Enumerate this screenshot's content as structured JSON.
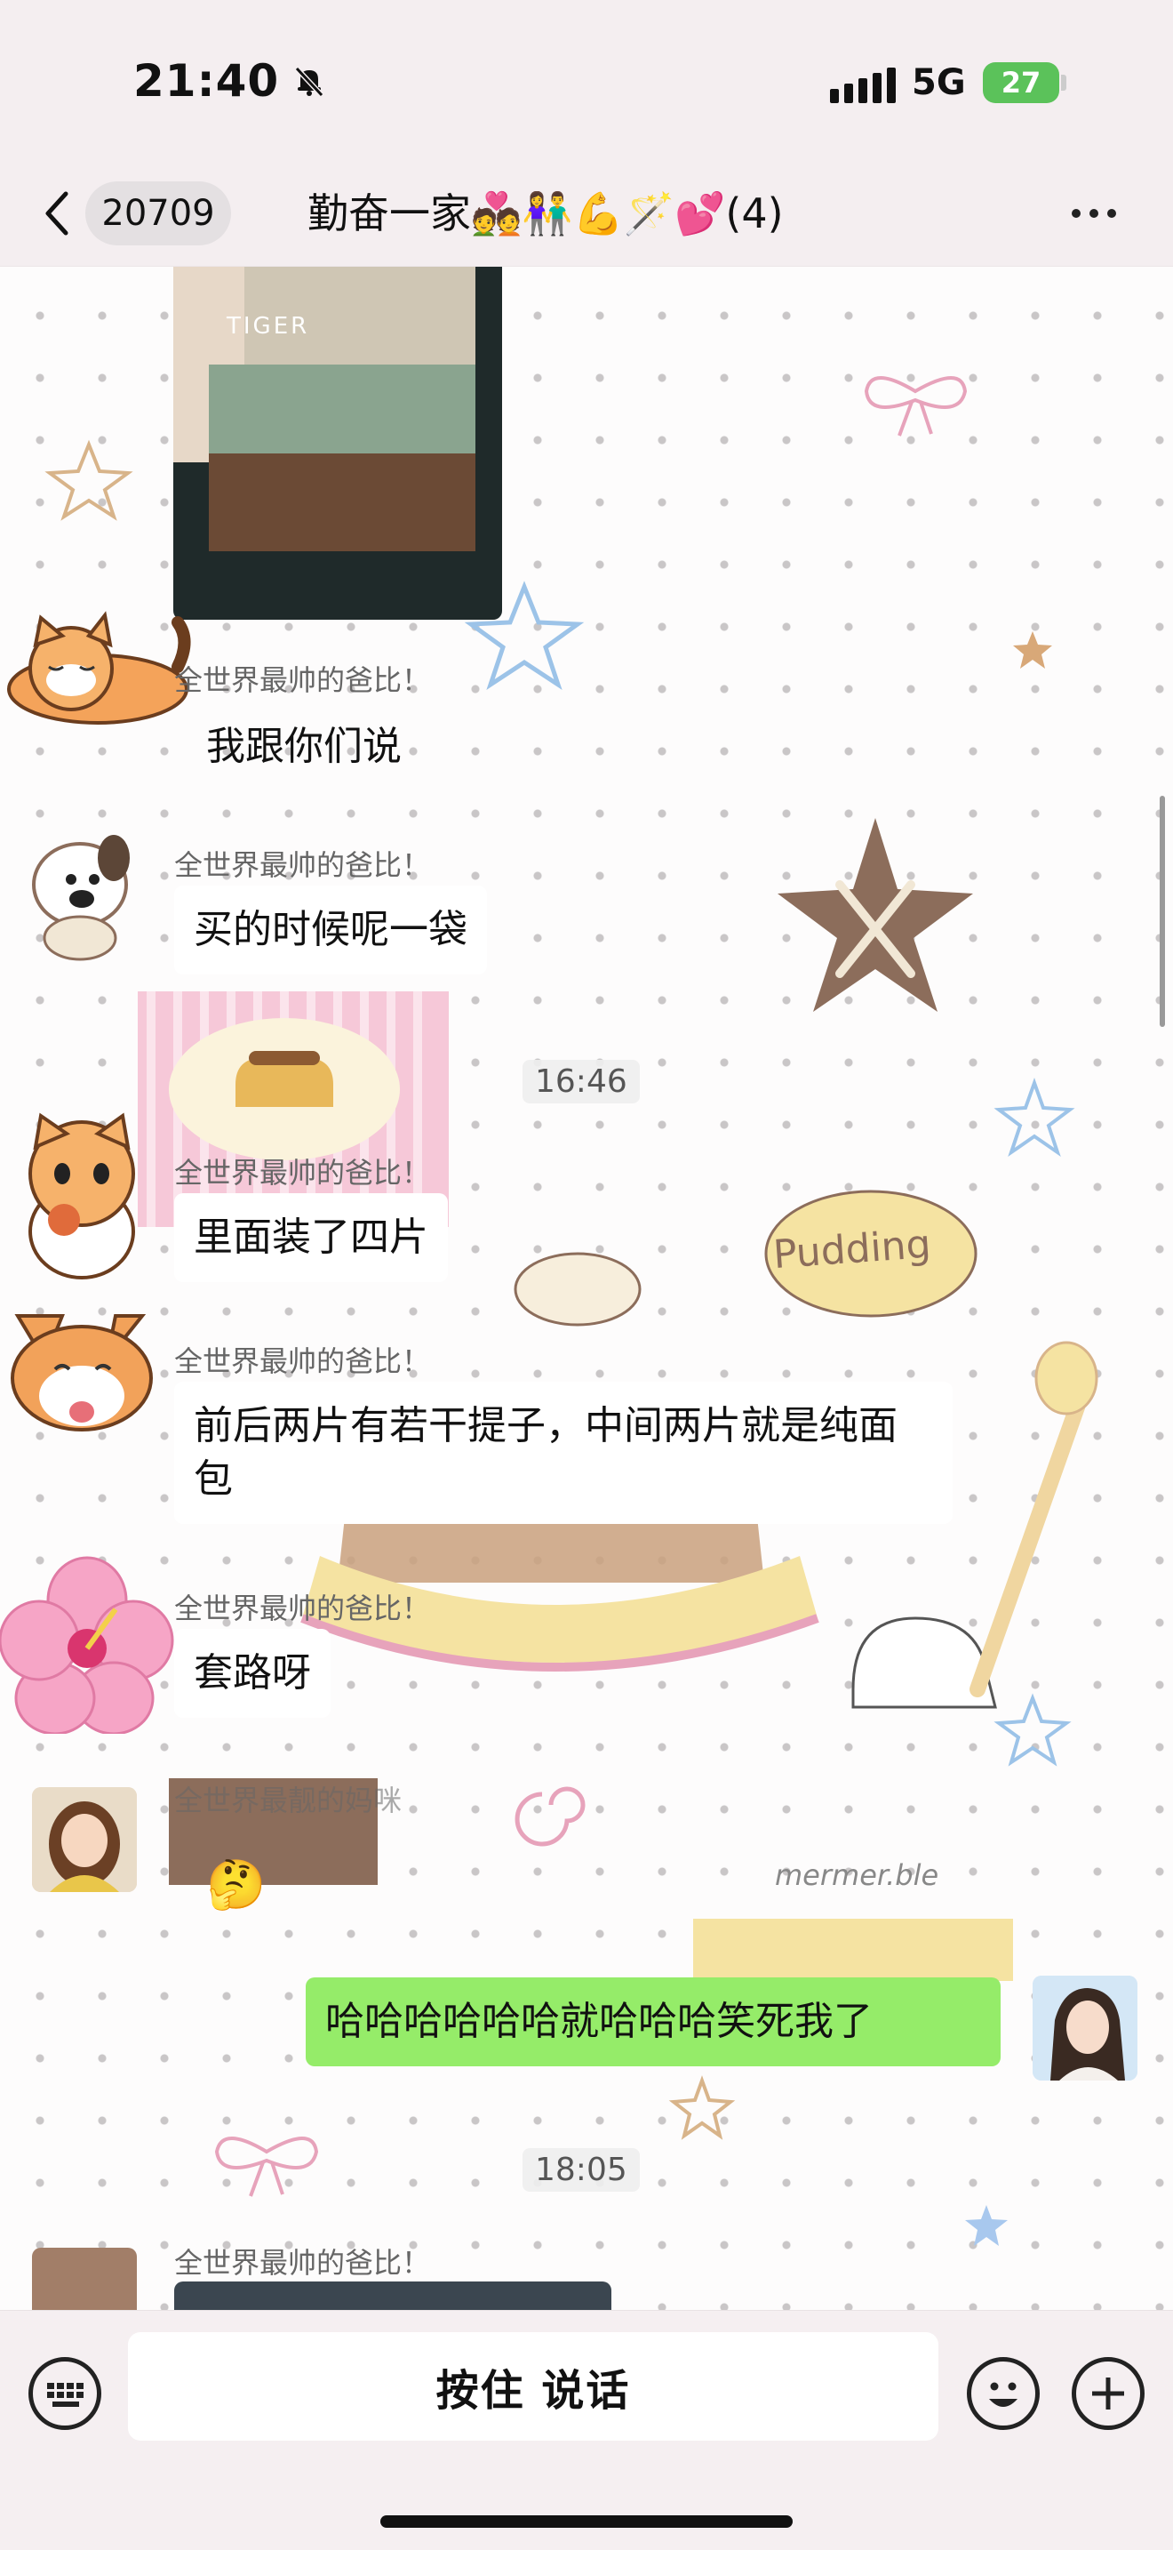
{
  "status_bar": {
    "time": "21:40",
    "network": "5G",
    "battery": "27"
  },
  "header": {
    "unread_count": "20709",
    "title": "勤奋一家💑👫💪🪄💕(4)"
  },
  "messages": [
    {
      "sender": "全世界最帅的爸比！",
      "text": "我跟你们说"
    },
    {
      "sender": "全世界最帅的爸比！",
      "text": "买的时候呢一袋"
    },
    {
      "sender": "全世界最帅的爸比！",
      "text": "里面装了四片"
    },
    {
      "sender": "全世界最帅的爸比！",
      "text": "前后两片有若干提子，中间两片就是纯面包"
    },
    {
      "sender": "全世界最帅的爸比！",
      "text": "套路呀"
    },
    {
      "sender": "全世界最靓的妈咪",
      "text": "🤔"
    },
    {
      "sender": "",
      "text": "哈哈哈哈哈哈就哈哈哈笑死我了"
    },
    {
      "sender": "全世界最帅的爸比！",
      "text": ""
    }
  ],
  "timestamps": [
    "16:46",
    "18:05"
  ],
  "image_overlay_text": "TIGER",
  "wallpaper_labels": {
    "pudding": "Pudding",
    "watermark": "mermer.ble"
  },
  "toolbar": {
    "voice_label": "按住 说话"
  },
  "icons": [
    "bell-slash-icon",
    "back-icon",
    "more-icon",
    "keyboard-icon",
    "emoji-icon",
    "plus-icon"
  ]
}
